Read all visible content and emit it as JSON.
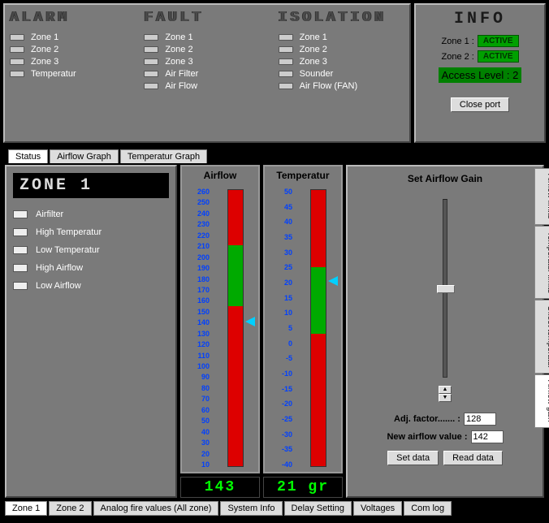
{
  "alarm": {
    "title": "ALARM",
    "items": [
      "Zone 1",
      "Zone 2",
      "Zone 3",
      "Temperatur"
    ]
  },
  "fault": {
    "title": "FAULT",
    "items": [
      "Zone 1",
      "Zone 2",
      "Zone 3",
      "Air Filter",
      "Air Flow"
    ]
  },
  "isolation": {
    "title": "ISOLATION",
    "items": [
      "Zone 1",
      "Zone 2",
      "Zone 3",
      "Sounder",
      "Air Flow (FAN)"
    ]
  },
  "info": {
    "title": "INFO",
    "rows": [
      {
        "label": "Zone 1 :",
        "badge": "ACTIVE"
      },
      {
        "label": "Zone 2 :",
        "badge": "ACTIVE"
      }
    ],
    "access_label": "Access Level : 2",
    "close_button": "Close port"
  },
  "top_tabs": [
    "Status",
    "Airflow Graph",
    "Temperatur Graph"
  ],
  "zone_panel": {
    "title": "ZONE 1",
    "items": [
      "Airfilter",
      "High Temperatur",
      "Low Temperatur",
      "High Airflow",
      "Low Airflow"
    ]
  },
  "gauges": {
    "airflow": {
      "title": "Airflow",
      "value": "143",
      "ticks": [
        "260",
        "250",
        "240",
        "230",
        "220",
        "210",
        "200",
        "190",
        "180",
        "170",
        "160",
        "150",
        "140",
        "130",
        "120",
        "110",
        "100",
        "90",
        "80",
        "70",
        "60",
        "50",
        "40",
        "30",
        "20",
        "10"
      ],
      "pointer_pct": 46
    },
    "temperature": {
      "title": "Temperatur",
      "value": "21 gr",
      "ticks": [
        "50",
        "45",
        "40",
        "35",
        "30",
        "25",
        "20",
        "15",
        "10",
        "5",
        "0",
        "-5",
        "-10",
        "-15",
        "-20",
        "-25",
        "-30",
        "-35",
        "-40"
      ],
      "pointer_pct": 32
    }
  },
  "gain": {
    "title": "Set Airflow Gain",
    "adj_label": "Adj. factor....... :",
    "adj_value": "128",
    "new_label": "New airflow value :",
    "new_value": "142",
    "set_btn": "Set data",
    "read_btn": "Read data",
    "side_tabs": [
      "Airflow limits",
      "Temperatur limits",
      "Offset temperatur",
      "Airflow gain"
    ]
  },
  "bottom_tabs": [
    "Zone 1",
    "Zone 2",
    "Analog fire values (All zone)",
    "System Info",
    "Delay Setting",
    "Voltages",
    "Com log"
  ]
}
